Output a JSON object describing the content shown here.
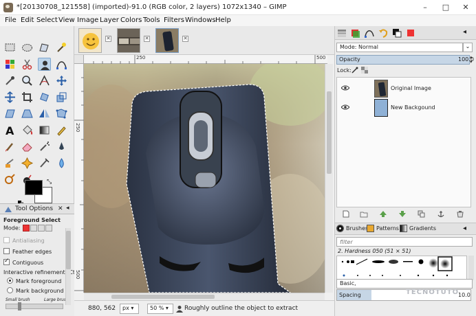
{
  "window": {
    "title": "*[20130708_121558] (imported)-91.0 (RGB color, 2 layers) 1072x1340 – GIMP",
    "controls": [
      "–",
      "□",
      "✕"
    ]
  },
  "menubar": [
    "File",
    "Edit",
    "Select",
    "View",
    "Image",
    "Layer",
    "Colors",
    "Tools",
    "Filters",
    "Windows",
    "Help"
  ],
  "toolbox": {
    "active_tool": "Foreground Select",
    "colors": {
      "foreground": "#000000",
      "background": "#ffffff"
    }
  },
  "tool_options": {
    "tab_label": "Tool Options",
    "tool_name": "Foreground Select",
    "mode_label": "Mode:",
    "antialiasing": {
      "label": "Antialiasing",
      "checked": false,
      "disabled": true
    },
    "feather_edges": {
      "label": "Feather edges",
      "checked": false
    },
    "contiguous": {
      "label": "Contiguous",
      "checked": true
    },
    "refinement_label": "Interactive refinement  (Ctrl)",
    "refinement_options": [
      {
        "label": "Mark foreground",
        "selected": true
      },
      {
        "label": "Mark background",
        "selected": false
      }
    ],
    "brush_labels": {
      "small": "Small brush",
      "large": "Large brush"
    }
  },
  "canvas": {
    "ruler_labels": {
      "h1": "250",
      "h2": "500",
      "v1": "250",
      "v2": "500"
    }
  },
  "statusbar": {
    "coords": "880, 562",
    "unit": "px",
    "zoom": "50 %",
    "message": "Roughly outline the object to extract"
  },
  "layers": {
    "mode_label": "Mode: Normal",
    "opacity_label": "Opacity",
    "opacity_value": "100.0",
    "lock_label": "Lock:",
    "items": [
      {
        "name": "Original Image",
        "visible": true
      },
      {
        "name": "New Backgound",
        "visible": true
      }
    ]
  },
  "brushes": {
    "tabs": [
      "Brushes",
      "Patterns",
      "Gradients"
    ],
    "filter_placeholder": "filter",
    "current_brush": "2. Hardness 050 (51 × 51)",
    "tag_value": "Basic,",
    "spacing_label": "Spacing",
    "spacing_value": "10.0"
  },
  "watermark": "TECNOTUTO"
}
